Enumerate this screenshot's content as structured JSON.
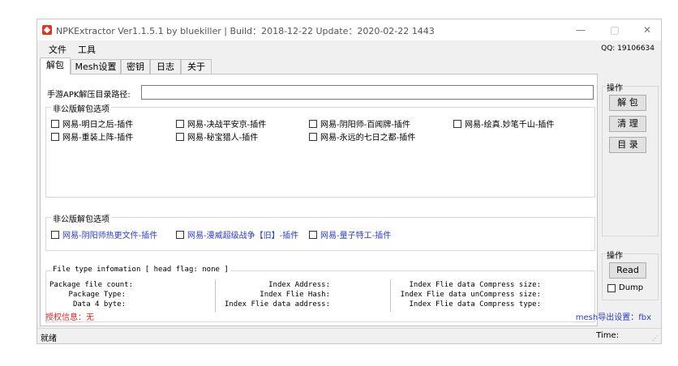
{
  "window": {
    "title": "NPKExtractor Ver1.1.5.1 by bluekiller | Build：2018-12-22  Update：2020-02-22 1443",
    "minimize": "—",
    "maximize": "□",
    "close": "✕"
  },
  "menu": {
    "items": [
      "文件",
      "工具"
    ],
    "qq": "QQ: 19106634"
  },
  "tabs": [
    "解包",
    "Mesh设置",
    "密钥",
    "日志",
    "关于"
  ],
  "unpack": {
    "path_label": "手游APK解压目录路径:",
    "path_value": "",
    "nonpublic_title": "非公版解包选项",
    "plugins_a": [
      "网易-明日之后-插件",
      "网易-决战平安京-插件",
      "网易-阴阳师-百闻牌-插件",
      "网易-绘真.妙笔千山-插件",
      "网易-重装上阵-插件",
      "网易-秘宝猎人-插件",
      "网易-永远的七日之都-插件"
    ],
    "nonpublic2_title": "非公版解包选项",
    "plugins_b": [
      "网易-阴阳师热更文件-插件",
      "网易-漫威超级战争【旧】-插件",
      "网易-量子特工-插件"
    ]
  },
  "ops": {
    "title": "操作",
    "unpack": "解 包",
    "clean": "清 理",
    "dir": "目 录"
  },
  "fileinfo": {
    "title": "File type infomation [ head flag: none ]",
    "col1": [
      "Package file count:",
      "Package Type:",
      "Data 4 byte:"
    ],
    "col2": [
      "Index Address:",
      "Index Flie Hash:",
      "Index Flie data address:"
    ],
    "col3": [
      "Index Flie data Compress size:",
      "Index Flie data unCompress size:",
      "Index Flie data Compress type:"
    ]
  },
  "ops2": {
    "title": "操作",
    "read": "Read",
    "dump": "Dump"
  },
  "auth": "授权信息：无",
  "mesh_export": "mesh导出设置：fbx",
  "status": {
    "left": "就绪",
    "right": "Time:"
  },
  "colors": {
    "auth_red": "#e0251e",
    "link_blue": "#2e3bd8"
  }
}
